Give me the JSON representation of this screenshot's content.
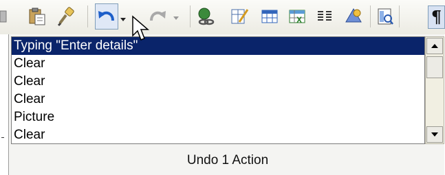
{
  "toolbar": {
    "icons": [
      "partial-icon",
      "paste-icon",
      "format-painter-icon",
      "undo-icon",
      "undo-dropdown-arrow-icon",
      "redo-icon",
      "redo-dropdown-arrow-icon",
      "hyperlink-icon",
      "draw-table-icon",
      "insert-table-icon",
      "insert-spreadsheet-icon",
      "columns-icon",
      "drawing-icon",
      "document-map-icon",
      "show-formatting-icon"
    ],
    "pilcrow": "¶"
  },
  "undo_list": {
    "items": [
      {
        "label": "Typing \"Enter details\"",
        "selected": true
      },
      {
        "label": "Clear",
        "selected": false
      },
      {
        "label": "Clear",
        "selected": false
      },
      {
        "label": "Clear",
        "selected": false
      },
      {
        "label": "Picture",
        "selected": false
      },
      {
        "label": "Clear",
        "selected": false
      }
    ],
    "status": "Undo 1 Action"
  },
  "colors": {
    "selection": "#0a246a",
    "selection_text": "#ffffff",
    "toolbar_highlight": "#dfe8f6"
  }
}
